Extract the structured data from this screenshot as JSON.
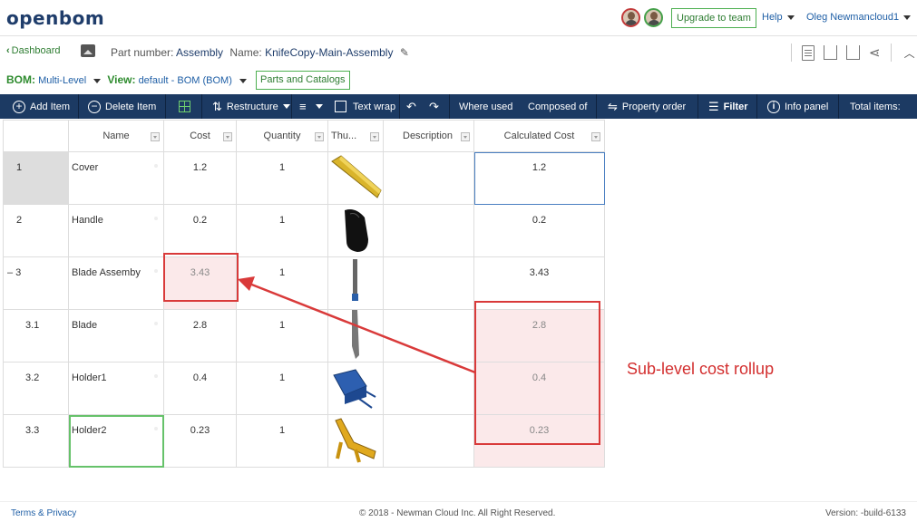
{
  "header": {
    "logo": "openbom",
    "upgrade_label": "Upgrade to team",
    "help_label": "Help",
    "user_name": "Oleg Newmancloud1"
  },
  "breadcrumb": {
    "dashboard_label": "Dashboard",
    "part_number_label": "Part number:",
    "part_number_value": "Assembly",
    "name_label": "Name:",
    "name_value": "KnifeCopy-Main-Assembly"
  },
  "bom_bar": {
    "bom_label": "BOM:",
    "bom_value": "Multi-Level",
    "view_label": "View:",
    "view_value": "default - BOM (BOM)",
    "parts_catalogs_label": "Parts and Catalogs"
  },
  "toolbar": {
    "add_item": "Add Item",
    "delete_item": "Delete Item",
    "restructure": "Restructure",
    "text_wrap": "Text wrap",
    "where_used": "Where used",
    "composed_of": "Composed of",
    "property_order": "Property order",
    "filter": "Filter",
    "info_panel": "Info panel",
    "total_items": "Total items:"
  },
  "table": {
    "columns": [
      "",
      "Name",
      "Cost",
      "Quantity",
      "Thu...",
      "Description",
      "Calculated Cost"
    ],
    "rows": [
      {
        "index": "1",
        "name": "Cover",
        "cost": "1.2",
        "quantity": "1",
        "thumbnail": "cover-thumbnail",
        "description": "",
        "calculated_cost": "1.2"
      },
      {
        "index": "2",
        "name": "Handle",
        "cost": "0.2",
        "quantity": "1",
        "thumbnail": "handle-thumbnail",
        "description": "",
        "calculated_cost": "0.2"
      },
      {
        "index": "– 3",
        "name": "Blade Assemby",
        "cost": "3.43",
        "quantity": "1",
        "thumbnail": "blade-assembly-thumbnail",
        "description": "",
        "calculated_cost": "3.43"
      },
      {
        "index": "3.1",
        "name": "Blade",
        "cost": "2.8",
        "quantity": "1",
        "thumbnail": "blade-thumbnail",
        "description": "",
        "calculated_cost": "2.8"
      },
      {
        "index": "3.2",
        "name": "Holder1",
        "cost": "0.4",
        "quantity": "1",
        "thumbnail": "holder1-thumbnail",
        "description": "",
        "calculated_cost": "0.4"
      },
      {
        "index": "3.3",
        "name": "Holder2",
        "cost": "0.23",
        "quantity": "1",
        "thumbnail": "holder2-thumbnail",
        "description": "",
        "calculated_cost": "0.23"
      }
    ]
  },
  "annotation": {
    "text": "Sub-level cost rollup",
    "color": "#d93a3a"
  },
  "footer": {
    "terms": "Terms & Privacy",
    "copyright": "© 2018 - Newman Cloud Inc. All Right Reserved.",
    "version": "Version: -build-6133"
  },
  "colors": {
    "toolbar_bg": "#1c3a63",
    "accent_green": "#2e8b2e",
    "link_blue": "#1f5fa6"
  }
}
